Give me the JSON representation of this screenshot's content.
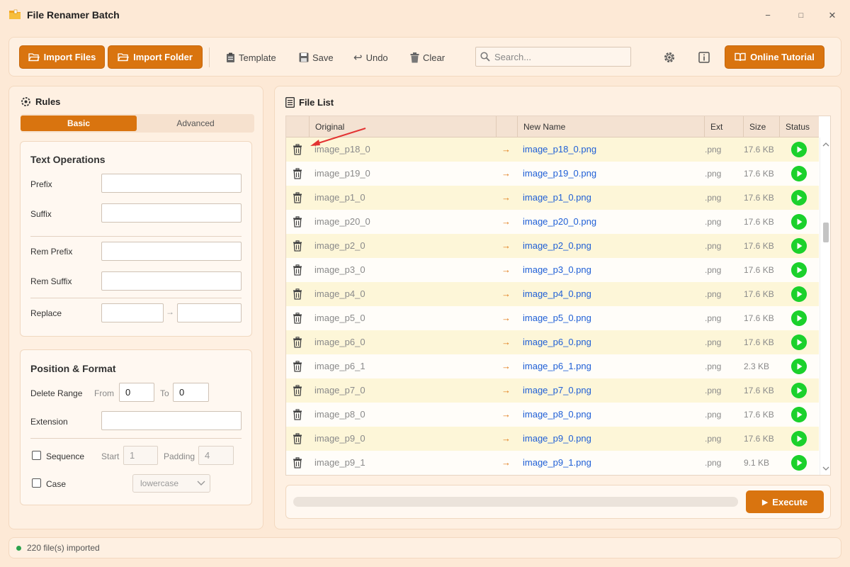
{
  "window": {
    "title": "File Renamer Batch",
    "minimize": "−",
    "maximize": "□",
    "close": "✕"
  },
  "toolbar": {
    "import_files": "Import Files",
    "import_folder": "Import Folder",
    "template": "Template",
    "save": "Save",
    "undo": "Undo",
    "clear": "Clear",
    "search_placeholder": "Search...",
    "online_tutorial": "Online Tutorial"
  },
  "rules": {
    "title": "Rules",
    "tabs": [
      "Basic",
      "Advanced"
    ],
    "active_tab": "Basic",
    "text_ops": {
      "title": "Text Operations",
      "prefix": "Prefix",
      "suffix": "Suffix",
      "rem_prefix": "Rem Prefix",
      "rem_suffix": "Rem Suffix",
      "replace": "Replace",
      "replace_arrow": "→",
      "prefix_value": "",
      "suffix_value": "",
      "rem_prefix_value": "",
      "rem_suffix_value": "",
      "replace_from_value": "",
      "replace_to_value": ""
    },
    "position_format": {
      "title": "Position & Format",
      "delete_range": "Delete Range",
      "from": "From",
      "to": "To",
      "from_value": "0",
      "to_value": "0",
      "extension": "Extension",
      "extension_value": "",
      "sequence": "Sequence",
      "start": "Start",
      "start_value": "1",
      "padding": "Padding",
      "padding_value": "4",
      "case": "Case",
      "case_value": "lowercase"
    }
  },
  "file_list": {
    "title": "File List",
    "columns": [
      "Original",
      "New Name",
      "Ext",
      "Size",
      "Status"
    ],
    "arrow": "→",
    "rows": [
      {
        "original": "image_p18_0",
        "new_name": "image_p18_0.png",
        "ext": ".png",
        "size": "17.6 KB"
      },
      {
        "original": "image_p19_0",
        "new_name": "image_p19_0.png",
        "ext": ".png",
        "size": "17.6 KB"
      },
      {
        "original": "image_p1_0",
        "new_name": "image_p1_0.png",
        "ext": ".png",
        "size": "17.6 KB"
      },
      {
        "original": "image_p20_0",
        "new_name": "image_p20_0.png",
        "ext": ".png",
        "size": "17.6 KB"
      },
      {
        "original": "image_p2_0",
        "new_name": "image_p2_0.png",
        "ext": ".png",
        "size": "17.6 KB"
      },
      {
        "original": "image_p3_0",
        "new_name": "image_p3_0.png",
        "ext": ".png",
        "size": "17.6 KB"
      },
      {
        "original": "image_p4_0",
        "new_name": "image_p4_0.png",
        "ext": ".png",
        "size": "17.6 KB"
      },
      {
        "original": "image_p5_0",
        "new_name": "image_p5_0.png",
        "ext": ".png",
        "size": "17.6 KB"
      },
      {
        "original": "image_p6_0",
        "new_name": "image_p6_0.png",
        "ext": ".png",
        "size": "17.6 KB"
      },
      {
        "original": "image_p6_1",
        "new_name": "image_p6_1.png",
        "ext": ".png",
        "size": "2.3 KB"
      },
      {
        "original": "image_p7_0",
        "new_name": "image_p7_0.png",
        "ext": ".png",
        "size": "17.6 KB"
      },
      {
        "original": "image_p8_0",
        "new_name": "image_p8_0.png",
        "ext": ".png",
        "size": "17.6 KB"
      },
      {
        "original": "image_p9_0",
        "new_name": "image_p9_0.png",
        "ext": ".png",
        "size": "17.6 KB"
      },
      {
        "original": "image_p9_1",
        "new_name": "image_p9_1.png",
        "ext": ".png",
        "size": "9.1 KB"
      }
    ],
    "progress": 0,
    "execute": "Execute"
  },
  "status": {
    "text": "220 file(s) imported"
  },
  "colors": {
    "accent": "#d9740f",
    "status_ok": "#1bd12c",
    "link": "#1f5fd6"
  }
}
